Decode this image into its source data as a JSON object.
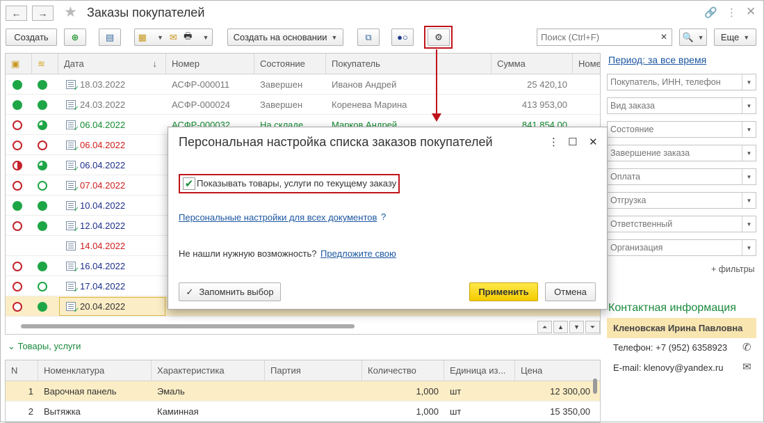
{
  "window": {
    "title": "Заказы покупателей"
  },
  "toolbar": {
    "create_label": "Создать",
    "create_based_label": "Создать на основании",
    "more_label": "Еще",
    "search_placeholder": "Поиск (Ctrl+F)"
  },
  "orders_table": {
    "columns": [
      "Дата",
      "Номер",
      "Состояние",
      "Покупатель",
      "Сумма",
      "Номе"
    ],
    "rows": [
      {
        "pay": "full",
        "ship": "full",
        "doc": "check",
        "date": "18.03.2022",
        "number": "АСФР-000011",
        "state": "Завершен",
        "customer": "Иванов Андрей",
        "sum": "25 420,10",
        "color": "dark"
      },
      {
        "pay": "full",
        "ship": "full",
        "doc": "check",
        "date": "24.03.2022",
        "number": "АСФР-000024",
        "state": "Завершен",
        "customer": "Коренева Марина",
        "sum": "413 953,00",
        "color": "dark"
      },
      {
        "pay": "empty",
        "ship": "part-green",
        "doc": "check",
        "date": "06.04.2022",
        "number": "АСФР-000032",
        "state": "На складе",
        "customer": "Марков Андрей",
        "sum": "841 854,00",
        "color": "green"
      },
      {
        "pay": "empty",
        "ship": "empty",
        "doc": "check",
        "date": "06.04.2022",
        "number": "",
        "state": "",
        "customer": "",
        "sum": "",
        "color": "red"
      },
      {
        "pay": "half-red",
        "ship": "part-green",
        "doc": "check",
        "date": "06.04.2022",
        "number": "",
        "state": "",
        "customer": "",
        "sum": "",
        "color": "blue"
      },
      {
        "pay": "empty",
        "ship": "ring",
        "doc": "check",
        "date": "07.04.2022",
        "number": "",
        "state": "",
        "customer": "",
        "sum": "",
        "color": "red"
      },
      {
        "pay": "full",
        "ship": "full",
        "doc": "check",
        "date": "10.04.2022",
        "number": "",
        "state": "",
        "customer": "",
        "sum": "",
        "color": "blue"
      },
      {
        "pay": "empty",
        "ship": "full",
        "doc": "check",
        "date": "12.04.2022",
        "number": "",
        "state": "",
        "customer": "",
        "sum": "",
        "color": "blue"
      },
      {
        "pay": "none",
        "ship": "none",
        "doc": "plain",
        "date": "14.04.2022",
        "number": "",
        "state": "",
        "customer": "",
        "sum": "",
        "color": "red"
      },
      {
        "pay": "empty",
        "ship": "full",
        "doc": "check",
        "date": "16.04.2022",
        "number": "",
        "state": "",
        "customer": "",
        "sum": "",
        "color": "blue"
      },
      {
        "pay": "empty",
        "ship": "ring",
        "doc": "check",
        "date": "17.04.2022",
        "number": "",
        "state": "",
        "customer": "",
        "sum": "",
        "color": "blue"
      },
      {
        "pay": "empty",
        "ship": "full",
        "doc": "check",
        "date": "20.04.2022",
        "number": "",
        "state": "",
        "customer": "",
        "sum": "",
        "color": "dark-black",
        "selected": true
      }
    ]
  },
  "goods": {
    "title": "Товары, услуги",
    "columns": [
      "N",
      "Номенклатура",
      "Характеристика",
      "Партия",
      "Количество",
      "Единица из...",
      "Цена"
    ],
    "rows": [
      {
        "n": "1",
        "item": "Варочная панель",
        "char": "Эмаль",
        "batch": "",
        "qty": "1,000",
        "unit": "шт",
        "price": "12 300,00",
        "selected": true
      },
      {
        "n": "2",
        "item": "Вытяжка",
        "char": "Каминная",
        "batch": "",
        "qty": "1,000",
        "unit": "шт",
        "price": "15 350,00"
      }
    ]
  },
  "filters": {
    "period_label": "Период: за все время",
    "fields": [
      "Покупатель, ИНН, телефон",
      "Вид заказа",
      "Состояние",
      "Завершение заказа",
      "Оплата",
      "Отгрузка",
      "Ответственный",
      "Организация"
    ],
    "add_filter_label": "+ фильтры"
  },
  "contact": {
    "heading": "Контактная информация",
    "name": "Кленовская Ирина Павловна",
    "phone": "Телефон: +7 (952) 6358923",
    "email": "E-mail: klenovy@yandex.ru"
  },
  "dialog": {
    "title": "Персональная настройка списка заказов покупателей",
    "checkbox_label": "Показывать товары, услуги по текущему заказу",
    "checkbox_checked": true,
    "link_all_docs": "Персональные настройки для всех документов",
    "help_mark": "?",
    "question": "Не нашли нужную возможность?",
    "suggest_link": "Предложите свою",
    "remember_label": "Запомнить выбор",
    "apply_label": "Применить",
    "cancel_label": "Отмена"
  },
  "colors": {
    "accent_green": "#1ea646",
    "accent_red": "#c4222b",
    "highlight_red": "#c0141a",
    "link_blue": "#1c57a0",
    "selection_yellow": "#fbedc5",
    "primary_yellow": "#f3cb00"
  }
}
